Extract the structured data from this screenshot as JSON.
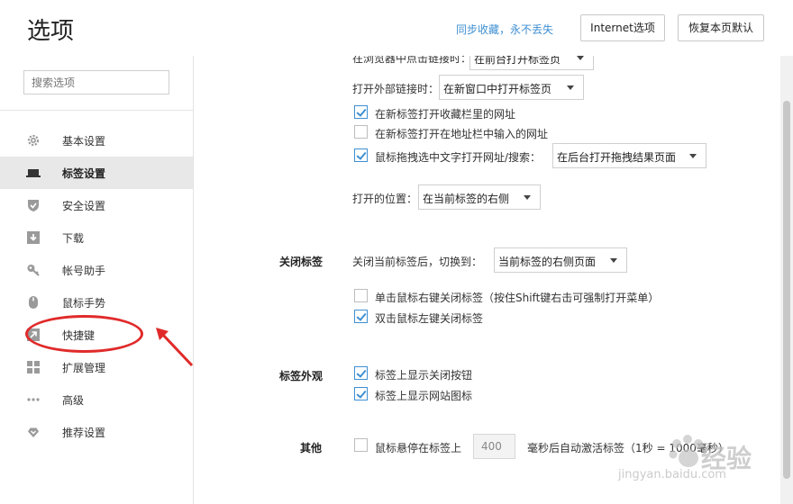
{
  "header": {
    "title": "选项",
    "sync_link": "同步收藏，永不丢失",
    "internet_options": "Internet选项",
    "restore_defaults": "恢复本页默认"
  },
  "sidebar": {
    "search_placeholder": "搜索选项",
    "active_item": "标签设置",
    "items": [
      {
        "label": "基本设置",
        "icon": "gear-icon"
      },
      {
        "label": "标签设置",
        "icon": "tab-icon"
      },
      {
        "label": "安全设置",
        "icon": "shield-icon"
      },
      {
        "label": "下载",
        "icon": "download-icon"
      },
      {
        "label": "帐号助手",
        "icon": "key-icon"
      },
      {
        "label": "鼠标手势",
        "icon": "mouse-icon"
      },
      {
        "label": "快捷键",
        "icon": "shortcut-icon"
      },
      {
        "label": "扩展管理",
        "icon": "grid-icon"
      },
      {
        "label": "高级",
        "icon": "more-icon"
      },
      {
        "label": "推荐设置",
        "icon": "heart-icon"
      }
    ]
  },
  "content": {
    "cut_row": {
      "label": "在浏览器中点击链接时：",
      "value": "在前台打开标签页"
    },
    "external_link": {
      "label": "打开外部链接时：",
      "value": "在新窗口中打开标签页"
    },
    "open_bookmark_new_tab": {
      "label": "在新标签打开收藏栏里的网址",
      "checked": true
    },
    "open_address_new_tab": {
      "label": "在新标签打开在地址栏中输入的网址",
      "checked": false
    },
    "drag_text": {
      "label": "鼠标拖拽选中文字打开网址/搜索：",
      "checked": true,
      "value": "在后台打开拖拽结果页面"
    },
    "open_position": {
      "label": "打开的位置：",
      "value": "在当前标签的右侧"
    },
    "close_tab": {
      "section": "关闭标签",
      "after_close_label": "关闭当前标签后，切换到：",
      "after_close_value": "当前标签的右侧页面",
      "right_click_close": {
        "label": "单击鼠标右键关闭标签（按住Shift键右击可强制打开菜单）",
        "checked": false
      },
      "double_click_close": {
        "label": "双击鼠标左键关闭标签",
        "checked": true
      }
    },
    "tab_appearance": {
      "section": "标签外观",
      "show_close": {
        "label": "标签上显示关闭按钮",
        "checked": true
      },
      "show_favicon": {
        "label": "标签上显示网站图标",
        "checked": true
      }
    },
    "other": {
      "section": "其他",
      "hover_label": "鼠标悬停在标签上",
      "hover_checked": false,
      "delay_value": "400",
      "delay_suffix": "毫秒后自动激活标签（1秒 = 1000毫秒）"
    }
  },
  "watermark": {
    "text": "经验",
    "url": "jingyan.baidu.com"
  },
  "colors": {
    "accent": "#3f8fd2",
    "annotation": "#e02a2a"
  }
}
